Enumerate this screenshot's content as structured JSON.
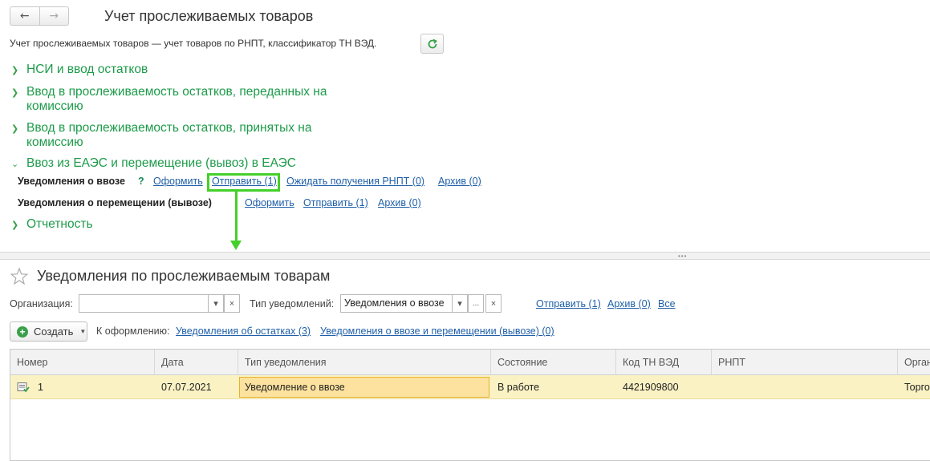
{
  "window": {
    "title": "Учет прослеживаемых товаров",
    "description": "Учет прослеживаемых товаров — учет товаров по РНПТ, классификатор ТН ВЭД."
  },
  "sections": [
    {
      "label": "НСИ и ввод остатков",
      "expanded": false
    },
    {
      "label": "Ввод в прослеживаемость остатков, переданных на комиссию",
      "expanded": false
    },
    {
      "label": "Ввод в прослеживаемость остатков, принятых на комиссию",
      "expanded": false
    },
    {
      "label": "Ввоз из ЕАЭС и перемещение (вывоз) в ЕАЭС",
      "expanded": true
    },
    {
      "label": "Отчетность",
      "expanded": false
    }
  ],
  "import_row": {
    "label": "Уведомления о ввозе",
    "help": "?",
    "links": [
      "Оформить",
      "Отправить (1)",
      "Ожидать получения РНПТ (0)",
      "Архив (0)"
    ]
  },
  "move_row": {
    "label": "Уведомления о перемещении (вывозе)",
    "links": [
      "Оформить",
      "Отправить (1)",
      "Архив (0)"
    ]
  },
  "list_form": {
    "title": "Уведомления по прослеживаемым товарам",
    "org_label": "Организация:",
    "org_value": "",
    "type_label": "Тип уведомлений:",
    "type_value": "Уведомления о ввозе",
    "filter_links": [
      "Отправить (1)",
      "Архив (0)",
      "Все"
    ],
    "create_label": "Создать",
    "todo_label": "К оформлению:",
    "todo_links": [
      "Уведомления об остатках (3)",
      "Уведомления о ввозе и перемещении (вывозе) (0)"
    ]
  },
  "table": {
    "columns": [
      "Номер",
      "Дата",
      "Тип уведомления",
      "Состояние",
      "Код ТН ВЭД",
      "РНПТ",
      "Орган"
    ],
    "rows": [
      {
        "number": "1",
        "date": "07.07.2021",
        "type": "Уведомление о ввозе",
        "state": "В работе",
        "code": "4421909800",
        "rnpt": "",
        "org": "Торго"
      }
    ]
  },
  "colors": {
    "accent_green": "#1d9b4a",
    "link_blue": "#1f5fa8",
    "highlight": "#44d02a",
    "row_selected": "#fbf2c4"
  },
  "icons": [
    "back-arrow-icon",
    "forward-arrow-icon",
    "refresh-icon",
    "chevron-right-icon",
    "chevron-down-icon",
    "star-icon",
    "plus-circle-icon",
    "document-icon"
  ]
}
